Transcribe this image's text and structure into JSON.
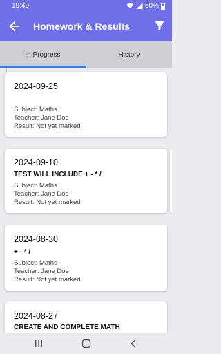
{
  "status": {
    "time": "19:49",
    "battery": "60%"
  },
  "header": {
    "title": "Homework & Results"
  },
  "tabs": [
    {
      "label": "In Progress",
      "active": true
    },
    {
      "label": "History",
      "active": false
    }
  ],
  "cards": [
    {
      "date": "2024-09-25",
      "title": "",
      "subject": "Subject: Maths",
      "teacher": "Teacher: Jane Doe",
      "result": "Result: Not yet marked"
    },
    {
      "date": "2024-09-10",
      "title": "TEST WILL INCLUDE + - * /",
      "subject": "Subject: Maths",
      "teacher": "Teacher: Jane Doe",
      "result": "Result: Not yet marked"
    },
    {
      "date": "2024-08-30",
      "title": "+ - * /",
      "subject": "Subject: Maths",
      "teacher": "Teacher: Jane Doe",
      "result": "Result: Not yet marked"
    },
    {
      "date": "2024-08-27",
      "title": "CREATE AND COMPLETE MATH"
    }
  ],
  "colors": {
    "primary": "#6f6fe8",
    "tab_indicator": "#3a7bea",
    "background": "#ececef"
  },
  "icons": {
    "back": "arrow-left-icon",
    "filter": "filter-icon",
    "nav_recents": "recents-icon",
    "nav_home": "home-icon",
    "nav_back": "nav-back-icon"
  }
}
